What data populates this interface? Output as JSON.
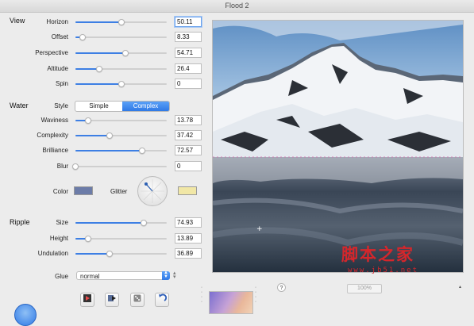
{
  "window": {
    "title": "Flood 2"
  },
  "view": {
    "heading": "View",
    "sliders": [
      {
        "label": "Horizon",
        "value": "50.11",
        "fraction": 0.5
      },
      {
        "label": "Offset",
        "value": "8.33",
        "fraction": 0.08
      },
      {
        "label": "Perspective",
        "value": "54.71",
        "fraction": 0.55
      },
      {
        "label": "Altitude",
        "value": "26.4",
        "fraction": 0.26
      },
      {
        "label": "Spin",
        "value": "0",
        "fraction": 0.5
      }
    ]
  },
  "water": {
    "heading": "Water",
    "style_label": "Style",
    "style_options": [
      "Simple",
      "Complex"
    ],
    "style_selected": "Complex",
    "sliders": [
      {
        "label": "Waviness",
        "value": "13.78",
        "fraction": 0.14
      },
      {
        "label": "Complexity",
        "value": "37.42",
        "fraction": 0.37
      },
      {
        "label": "Brilliance",
        "value": "72.57",
        "fraction": 0.73
      },
      {
        "label": "Blur",
        "value": "0",
        "fraction": 0.0
      }
    ],
    "color_label": "Color",
    "color_value": "#6c7ca8",
    "glitter_label": "Glitter",
    "glitter_value": "#f1e7a6"
  },
  "ripple": {
    "heading": "Ripple",
    "sliders": [
      {
        "label": "Size",
        "value": "74.93",
        "fraction": 0.75
      },
      {
        "label": "Height",
        "value": "13.89",
        "fraction": 0.14
      },
      {
        "label": "Undulation",
        "value": "36.89",
        "fraction": 0.37
      }
    ]
  },
  "glue": {
    "label": "Glue",
    "value": "normal"
  },
  "toolbar": {
    "icons": [
      "play-icon",
      "render-icon",
      "dice-icon",
      "undo-icon"
    ]
  },
  "preview": {
    "help": "?",
    "zoom": "100%"
  },
  "watermark": {
    "text": "脚本之家",
    "url": "www.jb51.net"
  },
  "colors": {
    "accent": "#3d7fe4"
  }
}
